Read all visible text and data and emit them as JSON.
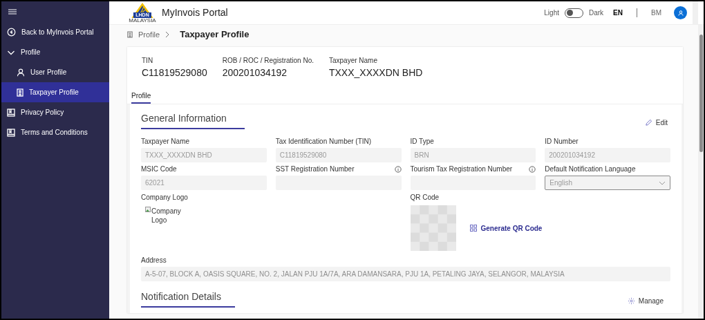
{
  "sidebar": {
    "items": [
      {
        "kind": "back",
        "label": "Back to MyInvois Portal",
        "selected": false
      },
      {
        "kind": "group",
        "label": "Profile",
        "expanded": true,
        "children": [
          {
            "kind": "user",
            "label": "User Profile",
            "selected": false
          },
          {
            "kind": "building",
            "label": "Taxpayer Profile",
            "selected": true
          }
        ]
      },
      {
        "kind": "book",
        "label": "Privacy Policy",
        "selected": false
      },
      {
        "kind": "book",
        "label": "Terms and Conditions",
        "selected": false
      }
    ]
  },
  "header": {
    "logo_text": "LHDN",
    "logo_subtext": "MALAYSIA",
    "title": "MyInvois Portal",
    "theme": {
      "left_label": "Light",
      "right_label": "Dark",
      "on": false
    },
    "languages": [
      {
        "label": "EN",
        "selected": true
      },
      {
        "label": "BM",
        "selected": false
      }
    ]
  },
  "breadcrumb": {
    "parent": "Profile",
    "current": "Taxpayer Profile"
  },
  "summary": [
    {
      "label": "TIN",
      "value": "C11819529080"
    },
    {
      "label": "ROB / ROC / Registration No.",
      "value": "200201034192"
    },
    {
      "label": "Taxpayer Name",
      "value": "TXXX_XXXXDN BHD"
    }
  ],
  "tabs": [
    {
      "label": "Profile",
      "selected": true
    }
  ],
  "general": {
    "title": "General Information",
    "action": "Edit",
    "fields": [
      {
        "kind": "text",
        "label": "Taxpayer Name",
        "value": "TXXX_XXXXDN BHD"
      },
      {
        "kind": "text",
        "label": "Tax Identification Number (TIN)",
        "value": "C11819529080"
      },
      {
        "kind": "text",
        "label": "ID Type",
        "value": "BRN"
      },
      {
        "kind": "text",
        "label": "ID Number",
        "value": "200201034192"
      },
      {
        "kind": "text",
        "label": "MSIC Code",
        "value": "62021"
      },
      {
        "kind": "text",
        "label": "SST Registration Number",
        "info": true
      },
      {
        "kind": "text",
        "label": "Tourism Tax Registration Number",
        "info": true
      },
      {
        "kind": "select",
        "label": "Default Notification Language",
        "value": "English"
      }
    ],
    "logo": {
      "label": "Company Logo",
      "alt": "Company Logo"
    },
    "qr": {
      "label": "QR Code",
      "action": "Generate QR Code"
    },
    "address": {
      "label": "Address",
      "value": "A-5-07, BLOCK A, OASIS SQUARE, NO. 2, JALAN PJU 1A/7A, ARA DAMANSARA, PJU 1A, PETALING JAYA, SELANGOR, MALAYSIA"
    }
  },
  "notification": {
    "title": "Notification Details",
    "action": "Manage"
  }
}
